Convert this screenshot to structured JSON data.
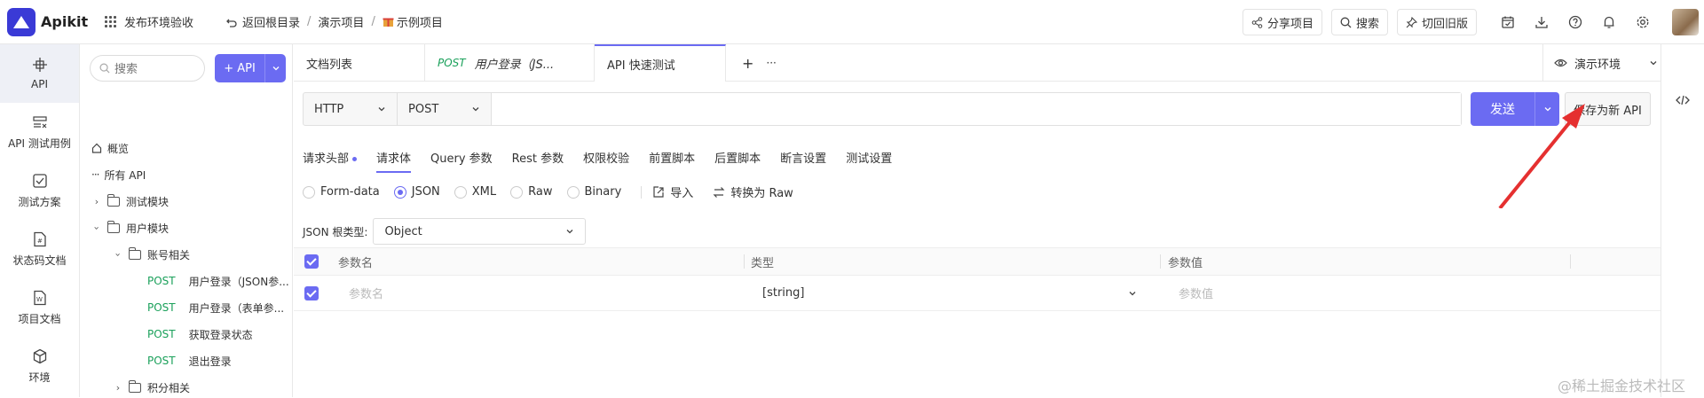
{
  "app": {
    "name": "Apikit"
  },
  "topbar": {
    "workspace": "发布环境验收",
    "back_root": "返回根目录",
    "breadcrumb_1": "演示项目",
    "breadcrumb_sep": "/",
    "breadcrumb_2": "示例项目",
    "share": "分享项目",
    "search": "搜索",
    "switch_old": "切回旧版"
  },
  "leftnav": {
    "items": [
      {
        "label": "API",
        "icon": "api-icon"
      },
      {
        "label": "API 测试用例",
        "icon": "test-case-icon"
      },
      {
        "label": "测试方案",
        "icon": "test-plan-icon"
      },
      {
        "label": "状态码文档",
        "icon": "status-doc-icon"
      },
      {
        "label": "项目文档",
        "icon": "project-doc-icon"
      },
      {
        "label": "环境",
        "icon": "env-icon"
      }
    ]
  },
  "tree": {
    "search_placeholder": "搜索",
    "add_api": "+ API",
    "overview": "概览",
    "all_api": "所有 API",
    "test_module": "测试模块",
    "user_module": "用户模块",
    "account": "账号相关",
    "apis": [
      {
        "method": "POST",
        "name": "用户登录（JSON参..."
      },
      {
        "method": "POST",
        "name": "用户登录（表单参..."
      },
      {
        "method": "POST",
        "name": "获取登录状态"
      },
      {
        "method": "POST",
        "name": "退出登录"
      }
    ],
    "points": "积分相关"
  },
  "tabs": {
    "doc_list": "文档列表",
    "t2_method": "POST",
    "t2_title": "用户登录（JS...",
    "t3": "API 快速测试",
    "plus": "+",
    "more": "···",
    "env": "演示环境"
  },
  "request": {
    "protocol": "HTTP",
    "method": "POST",
    "url": "",
    "send": "发送",
    "save_as": "保存为新 API"
  },
  "subtabs": [
    "请求头部",
    "请求体",
    "Query 参数",
    "Rest 参数",
    "权限校验",
    "前置脚本",
    "后置脚本",
    "断言设置",
    "测试设置"
  ],
  "body_types": [
    "Form-data",
    "JSON",
    "XML",
    "Raw",
    "Binary"
  ],
  "selected_body_type": "JSON",
  "tools": {
    "import": "导入",
    "to_raw": "转换为 Raw"
  },
  "root_type": {
    "label": "JSON 根类型:",
    "value": "Object"
  },
  "table": {
    "headers": [
      "参数名",
      "类型",
      "参数值"
    ],
    "row": {
      "name_ph": "参数名",
      "type": "[string]",
      "value_ph": "参数值"
    }
  },
  "watermark": "@稀土掘金技术社区",
  "colors": {
    "accent": "#6b6bf2",
    "post": "#1aa05a",
    "annotation": "#e53030"
  }
}
